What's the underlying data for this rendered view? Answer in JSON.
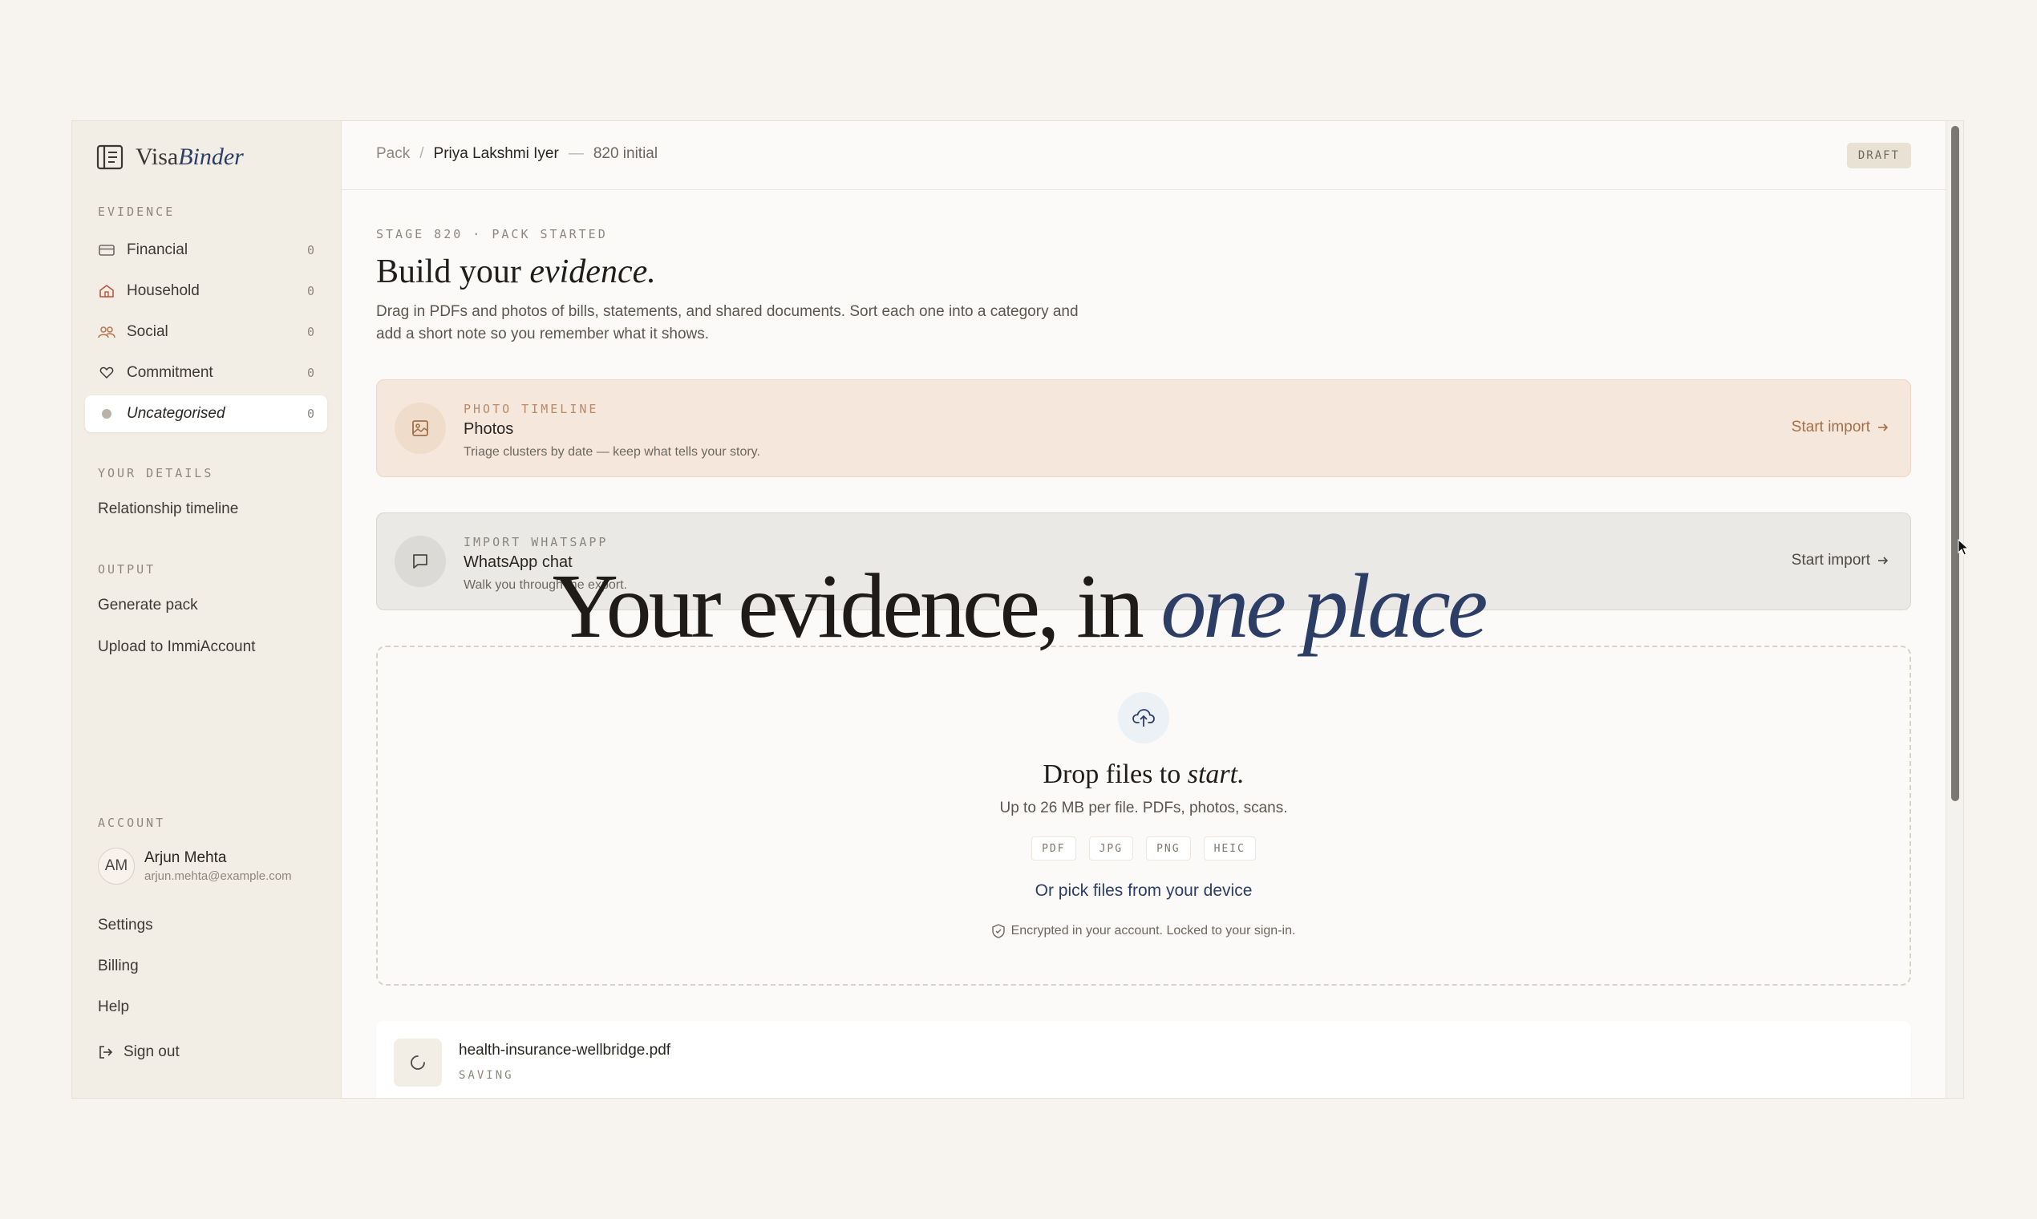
{
  "app": {
    "brand_part1": "Visa",
    "brand_part2": "Binder"
  },
  "sidebar": {
    "evidence_label": "EVIDENCE",
    "evidence_items": [
      {
        "label": "Financial",
        "count": "0",
        "icon": "credit-card-icon"
      },
      {
        "label": "Household",
        "count": "0",
        "icon": "home-icon"
      },
      {
        "label": "Social",
        "count": "0",
        "icon": "users-icon"
      },
      {
        "label": "Commitment",
        "count": "0",
        "icon": "heart-icon"
      },
      {
        "label": "Uncategorised",
        "count": "0",
        "icon": "dot-icon",
        "active": true
      }
    ],
    "details_label": "YOUR DETAILS",
    "relationship_timeline": "Relationship timeline",
    "output_label": "OUTPUT",
    "generate_pack": "Generate pack",
    "upload_immi": "Upload to ImmiAccount",
    "account_label": "ACCOUNT",
    "account": {
      "initials": "AM",
      "name": "Arjun Mehta",
      "email": "arjun.mehta@example.com"
    },
    "settings": "Settings",
    "billing": "Billing",
    "help": "Help",
    "sign_out": "Sign out"
  },
  "header": {
    "crumb_root": "Pack",
    "crumb_sep": "/",
    "crumb_name": "Priya Lakshmi Iyer",
    "crumb_dash": "—",
    "crumb_visa": "820 initial",
    "status_badge": "DRAFT"
  },
  "main": {
    "stage_label": "STAGE 820 · PACK STARTED",
    "heading_plain": "Build your ",
    "heading_em": "evidence.",
    "description": "Drag in PDFs and photos of bills, statements, and shared documents. Sort each one into a category and add a short note so you remember what it shows."
  },
  "import_cards": [
    {
      "kicker": "PHOTO TIMELINE",
      "title": "Photos",
      "subtitle": "Triage clusters by date — keep what tells your story.",
      "action": "Start import",
      "icon": "image-icon"
    },
    {
      "kicker": "IMPORT WHATSAPP",
      "title": "WhatsApp chat",
      "subtitle": "Walk you through the export.",
      "action": "Start import",
      "icon": "chat-bubble-icon"
    }
  ],
  "dropzone": {
    "title_plain": "Drop files to ",
    "title_em": "start.",
    "subtitle": "Up to 26 MB per file. PDFs, photos, scans.",
    "formats": [
      "PDF",
      "JPG",
      "PNG",
      "HEIC"
    ],
    "pick_link": "Or pick files from your device",
    "security_note": "Encrypted in your account. Locked to your sign-in."
  },
  "uploads": [
    {
      "filename": "health-insurance-wellbridge.pdf",
      "status": "SAVING"
    }
  ],
  "overlay": {
    "text_plain": "Your evidence, in ",
    "text_em": "one place"
  },
  "colors": {
    "accent_navy": "#2c3e66",
    "accent_terracotta": "#a56f48",
    "background": "#f7f4ef",
    "sidebar": "#f2ede5"
  }
}
